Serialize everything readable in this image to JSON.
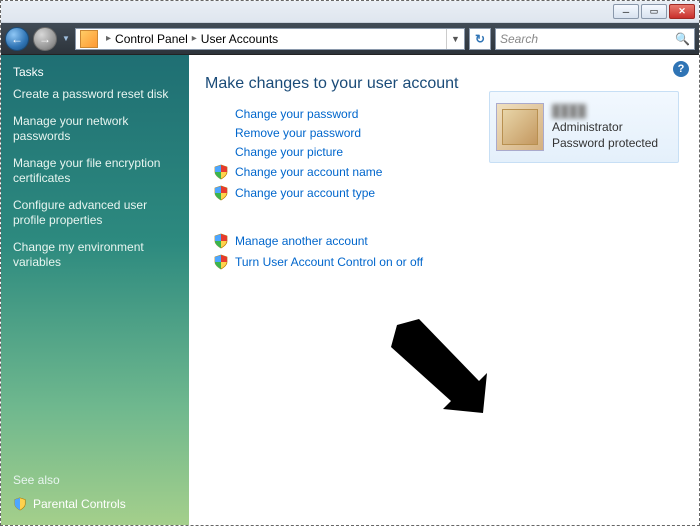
{
  "titlebar": {
    "minimize_glyph": "─",
    "maximize_glyph": "▭",
    "close_glyph": "✕"
  },
  "nav": {
    "back_glyph": "←",
    "fwd_glyph": "→",
    "refresh_glyph": "↻",
    "search_placeholder": "Search",
    "search_icon": "🔍"
  },
  "breadcrumbs": {
    "root": "Control Panel",
    "current": "User Accounts",
    "sep": "▸"
  },
  "sidebar": {
    "tasks_header": "Tasks",
    "items": [
      "Create a password reset disk",
      "Manage your network passwords",
      "Manage your file encryption certificates",
      "Configure advanced user profile properties",
      "Change my environment variables"
    ],
    "see_also_header": "See also",
    "see_also_items": [
      "Parental Controls"
    ]
  },
  "main": {
    "heading": "Make changes to your user account",
    "links_plain": [
      "Change your password",
      "Remove your password",
      "Change your picture"
    ],
    "links_shield_a": [
      "Change your account name",
      "Change your account type"
    ],
    "links_shield_b": [
      "Manage another account",
      "Turn User Account Control on or off"
    ],
    "help_glyph": "?"
  },
  "user_card": {
    "name": "████",
    "role": "Administrator",
    "status": "Password protected"
  }
}
